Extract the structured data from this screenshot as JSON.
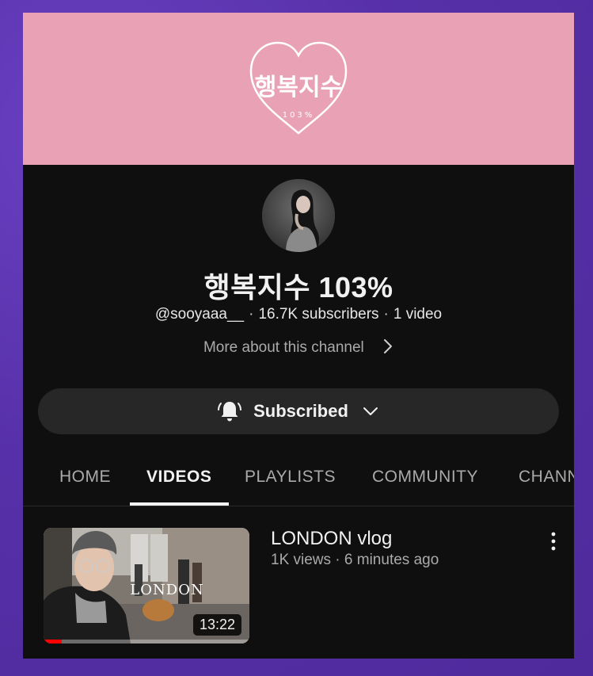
{
  "banner": {
    "logo_text": "행복지수",
    "logo_subtext": "103%",
    "background_color": "#e9a1b5"
  },
  "channel": {
    "name": "행복지수 103%",
    "handle": "@sooyaaa__",
    "subscribers": "16.7K subscribers",
    "video_count": "1 video",
    "more_about": "More about this channel"
  },
  "subscribe_button": {
    "label": "Subscribed",
    "icon": "bell-ringing-icon"
  },
  "tabs": [
    {
      "label": "HOME",
      "active": false
    },
    {
      "label": "VIDEOS",
      "active": true
    },
    {
      "label": "PLAYLISTS",
      "active": false
    },
    {
      "label": "COMMUNITY",
      "active": false
    },
    {
      "label": "CHANNELS",
      "active": false
    }
  ],
  "videos": [
    {
      "title": "LONDON vlog",
      "meta": "1K views · 6 minutes ago",
      "duration": "13:22",
      "thumbnail_text": "LONDON",
      "watched_fraction": 0.09
    }
  ],
  "colors": {
    "background": "#0f0f0f",
    "accent_red": "#ff0000",
    "outer_purple": "#5b33b0"
  }
}
